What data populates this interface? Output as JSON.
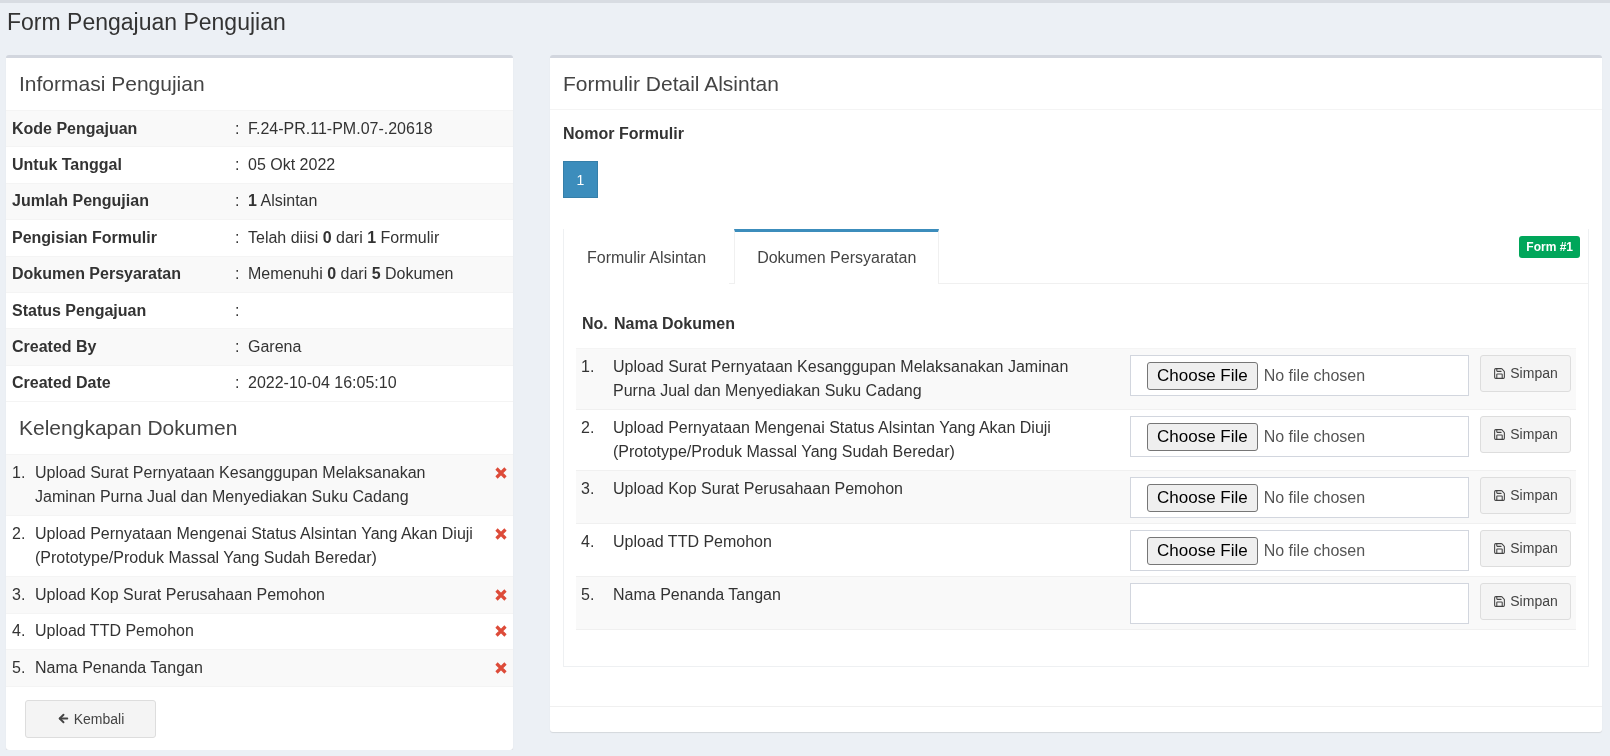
{
  "page_title": "Form Pengajuan Pengujian",
  "info_panel": {
    "title": "Informasi Pengujian",
    "rows": [
      {
        "label": "Kode Pengajuan",
        "separator": ":",
        "value": "F.24-PR.11-PM.07-.20618"
      },
      {
        "label": "Untuk Tanggal",
        "separator": ":",
        "value": "05 Okt 2022"
      },
      {
        "label": "Jumlah Pengujian",
        "separator": ":",
        "value": "**1** Alsintan"
      },
      {
        "label": "Pengisian Formulir",
        "separator": ":",
        "value": "Telah diisi **0** dari **1** Formulir"
      },
      {
        "label": "Dokumen Persyaratan",
        "separator": ":",
        "value": "Memenuhi **0** dari **5** Dokumen"
      },
      {
        "label": "Status Pengajuan",
        "separator": ":"
      },
      {
        "label": "Created By",
        "separator": ":",
        "value": "Garena"
      },
      {
        "label": "Created Date",
        "separator": ":",
        "value": "2022-10-04 16:05:10"
      }
    ]
  },
  "documents_panel": {
    "title": "Kelengkapan Dokumen",
    "items": [
      {
        "number": "1.",
        "name": "Upload Surat Pernyataan Kesanggupan Melaksanakan Jaminan Purna Jual dan Menyediakan Suku Cadang",
        "complete": false
      },
      {
        "number": "2.",
        "name": "Upload Pernyataan Mengenai Status Alsintan Yang Akan Diuji (Prototype/Produk Massal Yang Sudah Beredar)",
        "complete": false
      },
      {
        "number": "3.",
        "name": "Upload Kop Surat Perusahaan Pemohon",
        "complete": false
      },
      {
        "number": "4.",
        "name": "Upload TTD Pemohon",
        "complete": false
      },
      {
        "number": "5.",
        "name": "Nama Penanda Tangan",
        "complete": false
      }
    ]
  },
  "back_button": {
    "label": "Kembali"
  },
  "detail_panel": {
    "title": "Formulir Detail Alsintan",
    "form_number_label": "Nomor Formulir",
    "form_numbers": [
      {
        "label": "1",
        "selected": true
      }
    ],
    "tabs": [
      {
        "label": "Formulir Alsintan",
        "selected": false
      },
      {
        "label": "Dokumen Persyaratan",
        "selected": true
      }
    ],
    "badge": "Form #1",
    "table": {
      "columns": [
        "No.",
        "Nama Dokumen"
      ],
      "rows": [
        {
          "number": "1.",
          "name": "Upload Surat Pernyataan Kesanggupan Melaksanakan Jaminan Purna Jual dan Menyediakan Suku Cadang",
          "kind": "file",
          "button": "Choose File",
          "status": "No file chosen",
          "action": "Simpan"
        },
        {
          "number": "2.",
          "name": "Upload Pernyataan Mengenai Status Alsintan Yang Akan Diuji (Prototype/Produk Massal Yang Sudah Beredar)",
          "kind": "file",
          "button": "Choose File",
          "status": "No file chosen",
          "action": "Simpan"
        },
        {
          "number": "3.",
          "name": "Upload Kop Surat Perusahaan Pemohon",
          "kind": "file",
          "button": "Choose File",
          "status": "No file chosen",
          "action": "Simpan"
        },
        {
          "number": "4.",
          "name": "Upload TTD Pemohon",
          "kind": "file",
          "button": "Choose File",
          "status": "No file chosen",
          "action": "Simpan"
        },
        {
          "number": "5.",
          "name": "Nama Penanda Tangan",
          "kind": "text",
          "action": "Simpan"
        }
      ]
    }
  }
}
